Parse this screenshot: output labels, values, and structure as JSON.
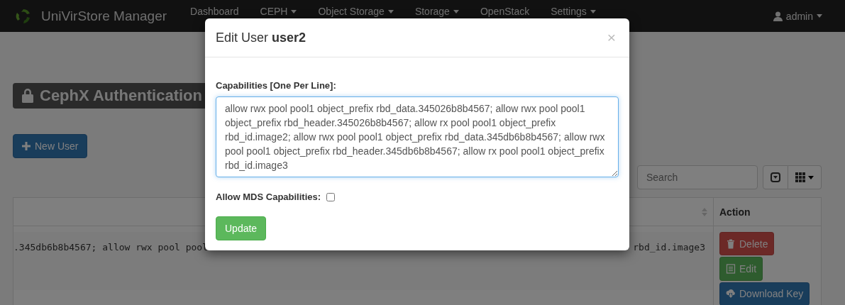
{
  "navbar": {
    "brand": "UniVirStore Manager",
    "items": [
      {
        "label": "Dashboard",
        "dropdown": false
      },
      {
        "label": "CEPH",
        "dropdown": true
      },
      {
        "label": "Object Storage",
        "dropdown": true
      },
      {
        "label": "Storage",
        "dropdown": true
      },
      {
        "label": "OpenStack",
        "dropdown": false
      },
      {
        "label": "Settings",
        "dropdown": true
      }
    ],
    "user": {
      "label": "admin"
    }
  },
  "page": {
    "title": "CephX Authentication",
    "new_user_button": "New User",
    "search": {
      "placeholder": "Search"
    },
    "table": {
      "columns": [
        "Action"
      ],
      "rows": [
        {
          "capabilities_start": ".345db6b8b4567; allow rwx pool pool",
          "capabilities_end": "rbd_id.image3",
          "actions": [
            {
              "kind": "delete",
              "label": "Delete"
            },
            {
              "kind": "edit",
              "label": "Edit"
            },
            {
              "kind": "download",
              "label": "Download Key"
            }
          ]
        }
      ]
    }
  },
  "modal": {
    "title": "Edit User **user2**",
    "close": "×",
    "capabilities_label": "Capabilities [One Per Line]:",
    "capabilities_value": "allow rwx pool pool1 object_prefix rbd_data.345026b8b4567; allow rwx pool pool1 object_prefix rbd_header.345026b8b4567; allow rx pool pool1 object_prefix rbd_id.image2; allow rwx pool pool1 object_prefix rbd_data.345db6b8b4567; allow rwx pool pool1 object_prefix rbd_header.345db6b8b4567; allow rx pool pool1 object_prefix rbd_id.image3",
    "mds_label": "Allow MDS Capabilities:",
    "mds_checked": false,
    "submit": "Update"
  }
}
